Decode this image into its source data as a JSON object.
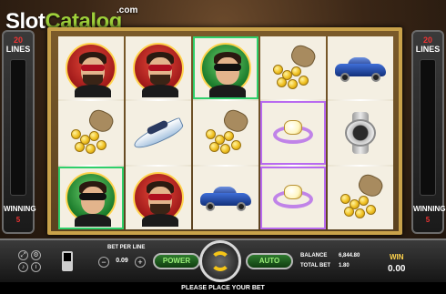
{
  "logo": {
    "word1": "Slot",
    "word2": "Catalog",
    "suffix": ".com"
  },
  "left_panel": {
    "lines_count": "20",
    "lines_label": "LINES",
    "winning_label": "WINNING",
    "winning_value": "5"
  },
  "right_panel": {
    "lines_count": "20",
    "lines_label": "LINES",
    "winning_label": "WINNING",
    "winning_value": "5"
  },
  "reels": [
    [
      "boss",
      "coins",
      "mask"
    ],
    [
      "boss",
      "speedboat",
      "boss"
    ],
    [
      "mask",
      "coins",
      "sports-car"
    ],
    [
      "coins",
      "ring",
      "ring"
    ],
    [
      "sports-car",
      "watch",
      "coins"
    ]
  ],
  "controls": {
    "bet_per_line_label": "BET PER LINE",
    "bet_per_line_value": "0.09",
    "minus": "−",
    "plus": "+",
    "power_label": "POWER",
    "auto_label": "AUTO",
    "balance_label": "BALANCE",
    "balance_value": "6,844.80",
    "total_bet_label": "TOTAL BET",
    "total_bet_value": "1.80",
    "win_label": "WIN",
    "win_value": "0.00",
    "message": "PLEASE PLACE YOUR BET"
  },
  "icons": [
    "fullscreen-icon",
    "settings-icon",
    "sound-icon",
    "info-icon",
    "battery-icon",
    "spin-arrows-icon"
  ],
  "colors": {
    "frame": "#c9a24a",
    "power_text": "#9df07a",
    "spin_arrows": "#f5c518",
    "lines_number": "#e33333"
  }
}
